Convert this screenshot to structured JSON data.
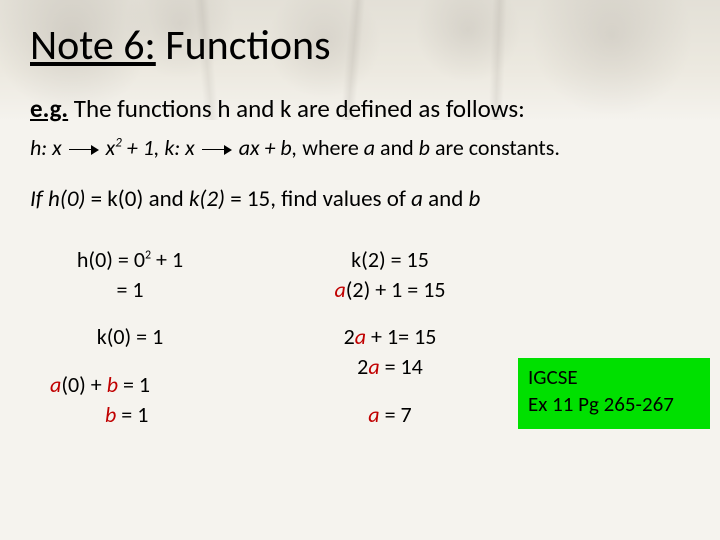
{
  "title": {
    "underlined": "Note 6:",
    "rest": "  Functions"
  },
  "eg_prefix": "e.g.",
  "eg_rest": "  The functions h and k are defined as follows:",
  "def": {
    "h_label": "h: x",
    "h_expr_pre": " x",
    "h_sup": "2",
    "h_expr_post": " + 1,  k: x",
    "k_expr": " ax + b,",
    "tail_plain_1": " where ",
    "tail_a": "a",
    "tail_plain_2": " and ",
    "tail_b": "b",
    "tail_plain_3": " are constants."
  },
  "problem": {
    "p1": "If h(0) ",
    "p2": "= k(0)  and ",
    "p3": "k(2) ",
    "p4": "= 15, find values of ",
    "a": "a ",
    "p5": "and ",
    "b": "b"
  },
  "col1": {
    "l1_pre": "h(0) = 0",
    "l1_sup": "2",
    "l1_post": " + 1",
    "l2": "= 1",
    "l3": "k(0) = 1",
    "l4_pre": "a",
    "l4_mid": "(0) + ",
    "l4_b": "b",
    "l4_end": "  = 1",
    "l5_b": "b",
    "l5_end": "  = 1"
  },
  "col2": {
    "l1": "k(2) = 15",
    "l2_a": "a",
    "l2_rest": "(2) + 1 = 15",
    "l3_pre": "2",
    "l3_a": "a",
    "l3_post": " + 1= 15",
    "l4_pre": "2",
    "l4_a": "a",
    "l4_post": " = 14",
    "l5_a": "a ",
    "l5_rest": "= 7"
  },
  "badge": {
    "l1": "IGCSE",
    "l2": "Ex 11  Pg 265-267"
  }
}
